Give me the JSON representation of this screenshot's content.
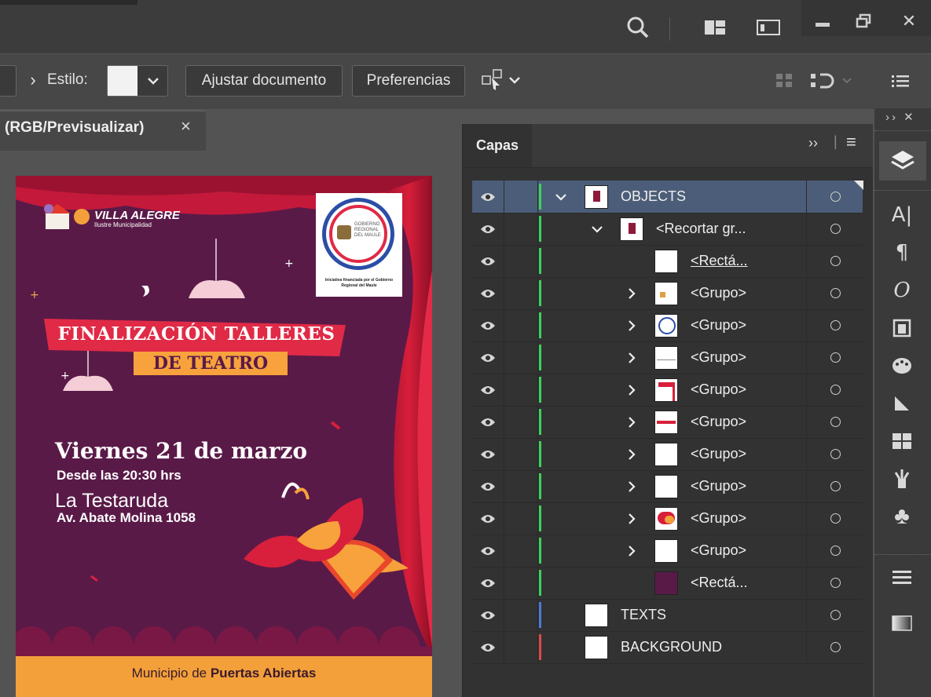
{
  "titlebar": {
    "icons": [
      "search-icon",
      "workspace-icon",
      "arrange-icon",
      "minimize-icon",
      "restore-icon",
      "close-icon"
    ],
    "close_glyph": "✕"
  },
  "controlbar": {
    "chevron": "›",
    "style_label": "Estilo:",
    "adjust_label": "Ajustar documento",
    "prefs_label": "Preferencias",
    "icons": [
      "transform-icon",
      "align-icon",
      "panel-menu-icon"
    ]
  },
  "document": {
    "tab_title": "(RGB/Previsualizar)",
    "tab_close": "×"
  },
  "poster": {
    "logo_title": "VILLA ALEGRE",
    "logo_sub": "Ilustre Municipalidad",
    "seal_lines": [
      "GOBIERNO",
      "REGIONAL",
      "DEL MAULE"
    ],
    "sponsor_note": "Iniciativa financiada por el Gobierno Regional del Maule",
    "banner_line1": "FINALIZACIÓN TALLERES",
    "banner_line2": "DE TEATRO",
    "date": "Viernes 21 de marzo",
    "time": "Desde las 20:30 hrs",
    "venue": "La Testaruda",
    "address": "Av. Abate Molina 1058",
    "footer_prefix": "Municipio de ",
    "footer_bold": "Puertas Abiertas"
  },
  "layers_panel": {
    "tab": "Capas",
    "header_more": "››",
    "header_sep": "|",
    "header_menu": "≡",
    "rows": [
      {
        "name": "OBJECTS",
        "level": 0,
        "expanded": true,
        "color": "#3bd25a",
        "selected": true,
        "thumb": "doc"
      },
      {
        "name": "<Recortar gr...",
        "level": 1,
        "expanded": true,
        "color": "#3bd25a",
        "thumb": "doc"
      },
      {
        "name": "<Rectá...",
        "level": 2,
        "color": "#3bd25a",
        "thumb": "white",
        "underline": true
      },
      {
        "name": "<Grupo>",
        "level": 2,
        "collapsed": true,
        "color": "#3bd25a",
        "thumb": "logo"
      },
      {
        "name": "<Grupo>",
        "level": 2,
        "collapsed": true,
        "color": "#3bd25a",
        "thumb": "seal"
      },
      {
        "name": "<Grupo>",
        "level": 2,
        "collapsed": true,
        "color": "#3bd25a",
        "thumb": "line"
      },
      {
        "name": "<Grupo>",
        "level": 2,
        "collapsed": true,
        "color": "#3bd25a",
        "thumb": "red"
      },
      {
        "name": "<Grupo>",
        "level": 2,
        "collapsed": true,
        "color": "#3bd25a",
        "thumb": "redline"
      },
      {
        "name": "<Grupo>",
        "level": 2,
        "collapsed": true,
        "color": "#3bd25a",
        "thumb": "white"
      },
      {
        "name": "<Grupo>",
        "level": 2,
        "collapsed": true,
        "color": "#3bd25a",
        "thumb": "white"
      },
      {
        "name": "<Grupo>",
        "level": 2,
        "collapsed": true,
        "color": "#3bd25a",
        "thumb": "mask"
      },
      {
        "name": "<Grupo>",
        "level": 2,
        "collapsed": true,
        "color": "#3bd25a",
        "thumb": "white"
      },
      {
        "name": "<Rectá...",
        "level": 2,
        "color": "#3bd25a",
        "thumb": "purple"
      },
      {
        "name": "TEXTS",
        "level": 0,
        "color": "#4a7bdc",
        "thumb": "white"
      },
      {
        "name": "BACKGROUND",
        "level": 0,
        "color": "#dc4a4a",
        "thumb": "white"
      }
    ]
  },
  "right_toolbar": {
    "top_glyphs": "›› ✕",
    "tools": [
      "layers-icon",
      "character-icon",
      "paragraph-icon",
      "opentype-icon",
      "artboards-icon",
      "color-icon",
      "gradient-icon",
      "swatches-icon",
      "brushes-icon",
      "symbols-icon",
      "stroke-icon",
      "transparency-icon"
    ]
  }
}
